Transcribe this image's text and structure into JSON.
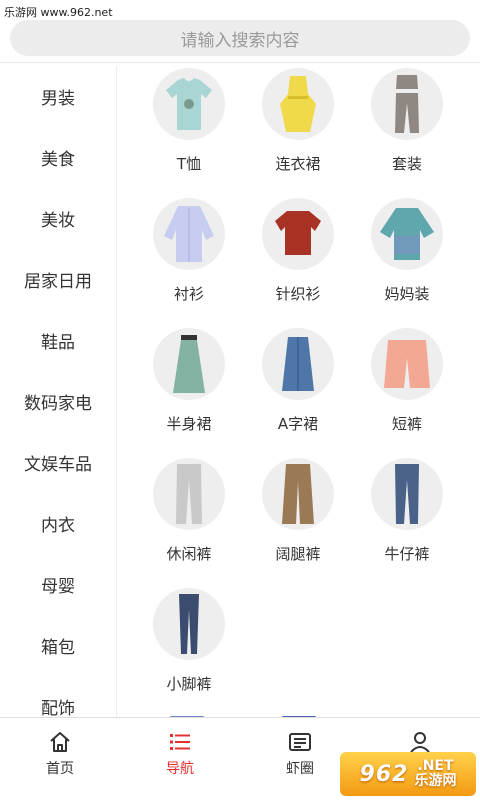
{
  "watermark_top": "乐游网 www.962.net",
  "search": {
    "placeholder": "请输入搜索内容"
  },
  "sidebar": {
    "items": [
      {
        "label": "男装"
      },
      {
        "label": "美食"
      },
      {
        "label": "美妆"
      },
      {
        "label": "居家日用"
      },
      {
        "label": "鞋品"
      },
      {
        "label": "数码家电"
      },
      {
        "label": "文娱车品"
      },
      {
        "label": "内衣"
      },
      {
        "label": "母婴"
      },
      {
        "label": "箱包"
      },
      {
        "label": "配饰"
      }
    ]
  },
  "grid": {
    "items": [
      {
        "label": "T恤",
        "icon": "tshirt-icon"
      },
      {
        "label": "连衣裙",
        "icon": "dress-icon"
      },
      {
        "label": "套装",
        "icon": "suit-set-icon"
      },
      {
        "label": "衬衫",
        "icon": "shirt-icon"
      },
      {
        "label": "针织衫",
        "icon": "knit-sweater-icon"
      },
      {
        "label": "妈妈装",
        "icon": "mom-top-icon"
      },
      {
        "label": "半身裙",
        "icon": "skirt-icon"
      },
      {
        "label": "A字裙",
        "icon": "a-line-skirt-icon"
      },
      {
        "label": "短裤",
        "icon": "shorts-icon"
      },
      {
        "label": "休闲裤",
        "icon": "casual-pants-icon"
      },
      {
        "label": "阔腿裤",
        "icon": "wide-leg-pants-icon"
      },
      {
        "label": "牛仔裤",
        "icon": "jeans-icon"
      },
      {
        "label": "小脚裤",
        "icon": "skinny-pants-icon"
      }
    ]
  },
  "tabbar": {
    "tabs": [
      {
        "label": "首页",
        "icon": "home-icon",
        "active": false
      },
      {
        "label": "导航",
        "icon": "list-icon",
        "active": true
      },
      {
        "label": "虾圈",
        "icon": "news-icon",
        "active": false
      },
      {
        "label": "我的",
        "icon": "user-icon",
        "active": false
      }
    ]
  },
  "brand_watermark": {
    "line1": "962",
    "line2a": ".NET",
    "line2b": "乐游网"
  },
  "colors": {
    "accent": "#e5302f",
    "text": "#333333",
    "circle_bg": "#eeeeee"
  }
}
